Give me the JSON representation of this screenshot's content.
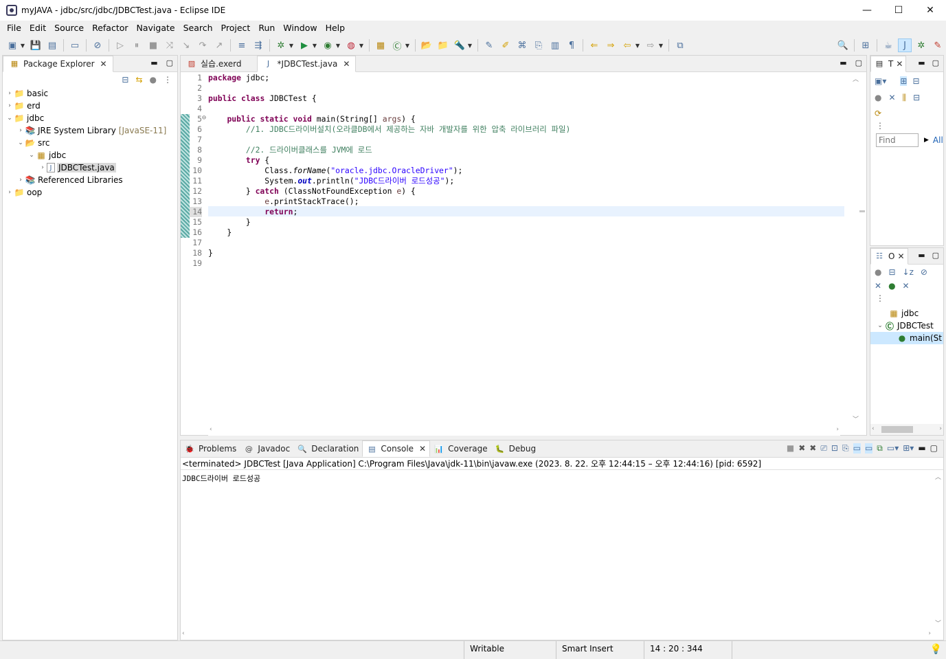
{
  "window": {
    "title": "myJAVA - jdbc/src/jdbc/JDBCTest.java - Eclipse IDE",
    "minimize": "—",
    "maximize": "☐",
    "close": "✕"
  },
  "menu": [
    "File",
    "Edit",
    "Source",
    "Refactor",
    "Navigate",
    "Search",
    "Project",
    "Run",
    "Window",
    "Help"
  ],
  "package_explorer": {
    "tab_label": "Package Explorer",
    "items": [
      {
        "label": "basic",
        "twisty": "›",
        "icon": "project-icon",
        "depth": 0
      },
      {
        "label": "erd",
        "twisty": "›",
        "icon": "project-icon",
        "depth": 0
      },
      {
        "label": "jdbc",
        "twisty": "⌄",
        "icon": "project-icon",
        "depth": 0
      },
      {
        "label": "JRE System Library",
        "suffix": "[JavaSE-11]",
        "twisty": "›",
        "icon": "library-icon",
        "depth": 1
      },
      {
        "label": "src",
        "twisty": "⌄",
        "icon": "source-folder-icon",
        "depth": 1
      },
      {
        "label": "jdbc",
        "twisty": "⌄",
        "icon": "package-icon",
        "depth": 2
      },
      {
        "label": "JDBCTest.java",
        "twisty": "›",
        "icon": "java-file-icon",
        "depth": 3,
        "selected": true
      },
      {
        "label": "Referenced Libraries",
        "twisty": "›",
        "icon": "library-icon",
        "depth": 1
      },
      {
        "label": "oop",
        "twisty": "›",
        "icon": "project-icon",
        "depth": 0
      }
    ]
  },
  "editor": {
    "tabs": [
      {
        "label": "실습.exerd",
        "active": false
      },
      {
        "label": "*JDBCTest.java",
        "active": true
      }
    ],
    "line_numbers": [
      "1",
      "2",
      "3",
      "4",
      "5",
      "6",
      "7",
      "8",
      "9",
      "10",
      "11",
      "12",
      "13",
      "14",
      "15",
      "16",
      "17",
      "18",
      "19"
    ],
    "fold_marker": "⊖",
    "code": {
      "l1": "package",
      "l1b": " jdbc;",
      "l3a": "public",
      "l3b": " ",
      "l3c": "class",
      "l3d": " JDBCTest {",
      "l5a": "    ",
      "l5b": "public",
      "l5c": " ",
      "l5d": "static",
      "l5e": " ",
      "l5f": "void",
      "l5g": " main(String[] ",
      "l5h": "args",
      "l5i": ") {",
      "l6": "        //1. JDBC드라이버설치(오라클DB에서 제공하는 자바 개발자를 위한 압축 라이브러리 파일)",
      "l8": "        //2. 드라이버클래스를 JVM에 로드",
      "l9a": "        ",
      "l9b": "try",
      "l9c": " {",
      "l10a": "            Class.",
      "l10b": "forName",
      "l10c": "(",
      "l10d": "\"oracle.jdbc.OracleDriver\"",
      "l10e": ");",
      "l11a": "            System.",
      "l11b": "out",
      "l11c": ".println(",
      "l11d": "\"JDBC드라이버 로드성공\"",
      "l11e": ");",
      "l12a": "        } ",
      "l12b": "catch",
      "l12c": " (ClassNotFoundException ",
      "l12d": "e",
      "l12e": ") {",
      "l13a": "            ",
      "l13b": "e",
      "l13c": ".printStackTrace();",
      "l14a": "            ",
      "l14b": "return",
      "l14c": ";",
      "l15": "        }",
      "l16": "    }",
      "l18": "}"
    }
  },
  "right_top": {
    "tab_label": "T",
    "find_placeholder": "Find",
    "all_label": "All"
  },
  "outline": {
    "tab_label": "O",
    "items": [
      {
        "label": "jdbc",
        "icon": "package-icon"
      },
      {
        "label": "JDBCTest",
        "icon": "class-icon"
      },
      {
        "label": "main(St",
        "icon": "method-icon"
      }
    ]
  },
  "bottom": {
    "tabs": [
      {
        "label": "Problems",
        "icon": "problems-icon",
        "glyph": "🐞"
      },
      {
        "label": "Javadoc",
        "icon": "javadoc-icon",
        "glyph": "@"
      },
      {
        "label": "Declaration",
        "icon": "declaration-icon",
        "glyph": "🔍"
      },
      {
        "label": "Console",
        "icon": "console-icon",
        "glyph": "▤",
        "active": true
      },
      {
        "label": "Coverage",
        "icon": "coverage-icon",
        "glyph": "📊"
      },
      {
        "label": "Debug",
        "icon": "debug-icon",
        "glyph": "🐛"
      }
    ],
    "console_header": "<terminated> JDBCTest [Java Application] C:\\Program Files\\Java\\jdk-11\\bin\\javaw.exe  (2023. 8. 22. 오후 12:44:15 – 오후 12:44:16) [pid: 6592]",
    "console_output": "JDBC드라이버 로드성공"
  },
  "status": {
    "writable": "Writable",
    "insert_mode": "Smart Insert",
    "position": "14 : 20 : 344"
  },
  "colors": {
    "keyword": "#7f0055",
    "comment": "#3f7f5f",
    "string": "#2a00ff",
    "field": "#0000c0",
    "current_line": "#e8f2fe",
    "selection": "#cce8ff"
  }
}
